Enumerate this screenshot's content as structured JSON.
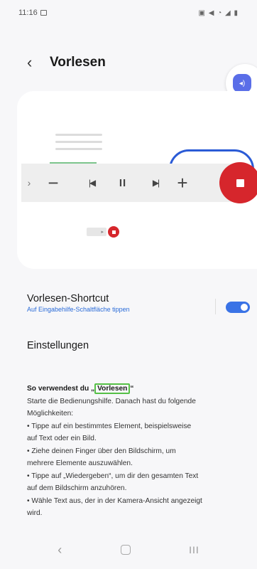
{
  "status_bar": {
    "time": "11:16",
    "right_icons": "▣ ◀ ◔ ◢ ▮"
  },
  "header": {
    "back_glyph": "‹",
    "title": "Vorlesen"
  },
  "floating_button": {
    "icon": "speaker-icon",
    "glyph": "◂)"
  },
  "player": {
    "handle": "›",
    "minus": "−",
    "prev": "|◀",
    "pause": "II",
    "next": "▶|",
    "plus": "+",
    "mini_arrow": "▸"
  },
  "shortcut": {
    "title": "Vorlesen-Shortcut",
    "subtitle": "Auf Eingabehilfe-Schaltfläche tippen",
    "enabled": true
  },
  "settings": {
    "title": "Einstellungen"
  },
  "howto": {
    "title_prefix": "So verwendest du „",
    "title_highlight": "Vorlesen",
    "title_suffix": "“",
    "lines": [
      "Starte die Bedienungshilfe. Danach hast du folgende",
      "Möglichkeiten:",
      "• Tippe auf ein bestimmtes Element, beispielsweise",
      "auf Text oder ein Bild.",
      "• Ziehe deinen Finger über den Bildschirm, um",
      "mehrere Elemente auszuwählen.",
      "• Tippe auf „Wiedergeben“, um dir den gesamten Text",
      "auf dem Bildschirm anzuhören.",
      "• Wähle Text aus, der in der Kamera-Ansicht angezeigt",
      "wird."
    ]
  },
  "nav": {
    "back": "‹",
    "recent": "III"
  },
  "colors": {
    "accent": "#3a73e6",
    "stop": "#d6262c",
    "highlight": "#55c046",
    "link": "#2a6bd8"
  }
}
